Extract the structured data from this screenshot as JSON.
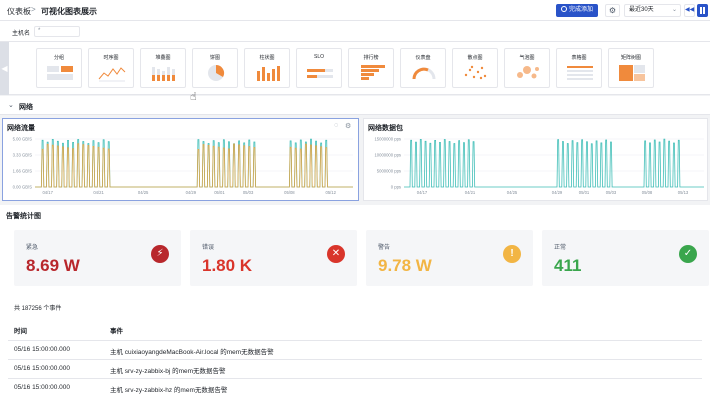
{
  "header": {
    "breadcrumb_home": "仪表板",
    "breadcrumb_sep": ">",
    "breadcrumb_current": "可视化图表展示",
    "add_button": "完成添加",
    "time_range": "最近30天"
  },
  "filter": {
    "label": "主机名",
    "value": "*"
  },
  "gallery": [
    {
      "title": "分组",
      "thumb": "table-icon"
    },
    {
      "title": "时序图",
      "thumb": "line-icon"
    },
    {
      "title": "堆叠图",
      "thumb": "bar-icon"
    },
    {
      "title": "饼图",
      "thumb": "pie-icon"
    },
    {
      "title": "柱状图",
      "thumb": "column-icon"
    },
    {
      "title": "SLO",
      "thumb": "slo-icon"
    },
    {
      "title": "排行榜",
      "thumb": "rank-icon"
    },
    {
      "title": "仪表盘",
      "thumb": "gauge-icon"
    },
    {
      "title": "散点图",
      "thumb": "scatter-icon"
    },
    {
      "title": "气泡图",
      "thumb": "bubble-icon"
    },
    {
      "title": "表格图",
      "thumb": "table-list-icon"
    },
    {
      "title": "矩阵树图",
      "thumb": "treemap-icon"
    }
  ],
  "section": {
    "title": "网络"
  },
  "chart_data": [
    {
      "type": "line",
      "title": "网络流量",
      "y_ticks": [
        "0.00 GB/S",
        "1.66 GB/S",
        "3.33 GB/S",
        "5.00 GB/S"
      ],
      "x_ticks": [
        "04/17",
        "04/21",
        "04/25",
        "04/29",
        "05/01",
        "05/03",
        "05/08",
        "05/12"
      ],
      "series": [
        {
          "name": "",
          "color": "#2eb8b0",
          "style": "spikes"
        },
        {
          "name": "",
          "color": "#e9a23b",
          "style": "spikes"
        }
      ]
    },
    {
      "type": "line",
      "title": "网络数据包",
      "y_ticks": [
        "0 pps",
        "5000000 pps",
        "10000000 pps",
        "15000000 pps"
      ],
      "x_ticks": [
        "04/17",
        "04/21",
        "04/25",
        "04/29",
        "05/01",
        "05/03",
        "05/08",
        "05/13"
      ],
      "series": [
        {
          "name": "",
          "color": "#2eb8b0",
          "style": "spikes"
        }
      ]
    }
  ],
  "alarm": {
    "title": "告警统计图",
    "cards": [
      {
        "label": "紧急",
        "value": "8.69 W",
        "color": "#b8272c",
        "icon": "bolt-icon",
        "glyph": "⚡"
      },
      {
        "label": "错误",
        "value": "1.80 K",
        "color": "#d9352b",
        "icon": "close-icon",
        "glyph": "✕"
      },
      {
        "label": "警告",
        "value": "9.78 W",
        "color": "#f2b544",
        "icon": "exclamation-icon",
        "glyph": "!"
      },
      {
        "label": "正常",
        "value": "411",
        "color": "#3aa64d",
        "icon": "check-icon",
        "glyph": "✓"
      }
    ],
    "event_count": "共 187256 个事件",
    "columns": {
      "time": "时间",
      "event": "事件"
    },
    "events": [
      {
        "time": "05/16 15:00:00.000",
        "text": "主机 cuixiaoyangdeMacBook-Air.local 的mem无数据告警"
      },
      {
        "time": "05/16 15:00:00.000",
        "text": "主机 srv-zy-zabbix-bj 的mem无数据告警"
      },
      {
        "time": "05/16 15:00:00.000",
        "text": "主机 srv-zy-zabbix-hz 的mem无数据告警"
      }
    ]
  }
}
